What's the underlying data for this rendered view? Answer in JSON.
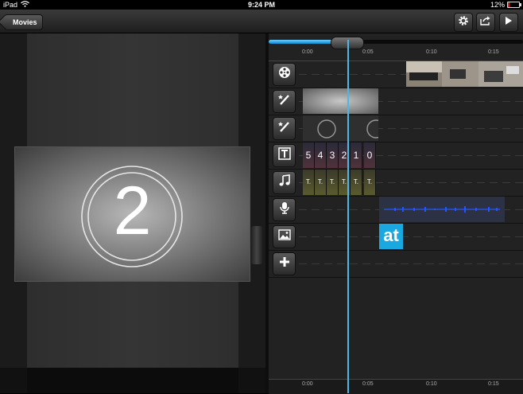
{
  "status_bar": {
    "device": "iPad",
    "time": "9:24 PM",
    "battery": "12%"
  },
  "toolbar": {
    "back_label": "Movies"
  },
  "preview": {
    "countdown_number": "2"
  },
  "timeline": {
    "ruler_top": [
      "0:00",
      "0:05",
      "0:10",
      "0:15"
    ],
    "ruler_bottom": [
      "0:00",
      "0:05",
      "0:10",
      "0:15"
    ],
    "countdown_digits": [
      "5",
      "4",
      "3",
      "2",
      "1",
      "0"
    ],
    "audio_labels": [
      "T.",
      "T.",
      "T.",
      "T.",
      "T.",
      "T."
    ],
    "logo_text": "at",
    "scrub_progress": 0.28
  },
  "colors": {
    "accent": "#4db8e8",
    "logo_bg": "#1aa8e0",
    "voice_wave": "#2255ff"
  }
}
